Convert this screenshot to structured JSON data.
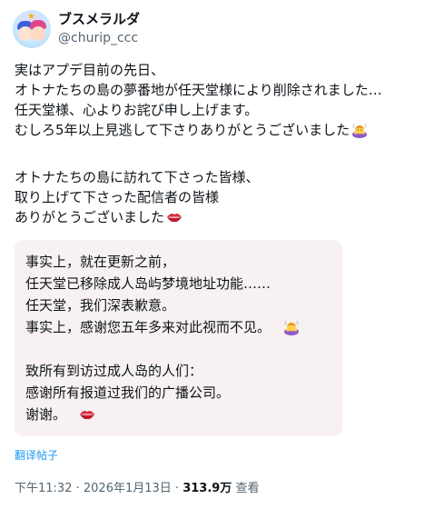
{
  "author": {
    "display_name": "ブスメラルダ",
    "handle": "@churip_ccc"
  },
  "post": {
    "paragraph1": [
      "実はアプデ目前の先日、",
      "オトナたちの島の夢番地が任天堂様により削除されました…",
      "任天堂様、心よりお詫び申し上げます。",
      "むしろ5年以上見逃して下さりありがとうございました"
    ],
    "paragraph2": [
      "オトナたちの島に訪れて下さった皆様、",
      "取り上げて下さった配信者の皆様",
      "ありがとうございました"
    ]
  },
  "translation": {
    "paragraph1": [
      "事实上，就在更新之前，",
      "任天堂已移除成人岛屿梦境地址功能……",
      "任天堂，我们深表歉意。",
      "事实上，感谢您五年多来对此视而不见。"
    ],
    "paragraph2": [
      "致所有到访过成人岛的人们：",
      "感谢所有报道过我们的广播公司。",
      "谢谢。"
    ]
  },
  "translate_link": "翻译帖子",
  "meta": {
    "time": "下午11:32",
    "separator": " · ",
    "date": "2026年1月13日",
    "views_count": "313.9万",
    "views_label": " 查看"
  },
  "icons": {
    "bowing_person": "person-bowing-icon",
    "lips": "kiss-mark-icon"
  },
  "colors": {
    "text": "#0f1419",
    "secondary": "#536471",
    "link": "#1d9bf0",
    "translation_bg": "#f7f1f1"
  }
}
